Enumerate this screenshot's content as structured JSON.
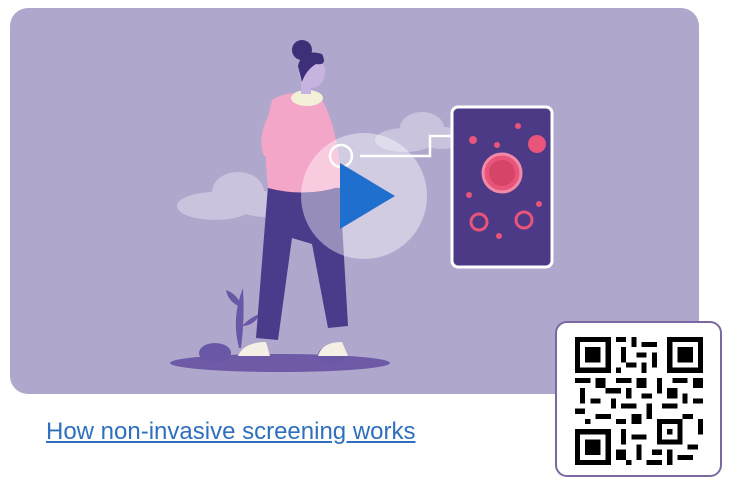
{
  "video": {
    "link_text": "How non-invasive screening works",
    "play_icon": "play-icon",
    "colors": {
      "background": "#b0a8cc",
      "play_triangle": "#1f6fcf",
      "screen_panel": "#4c3a86",
      "cells": "#e8547a"
    }
  },
  "qr_code": {
    "icon": "qr-code-icon",
    "border_color": "#7b68a3"
  }
}
